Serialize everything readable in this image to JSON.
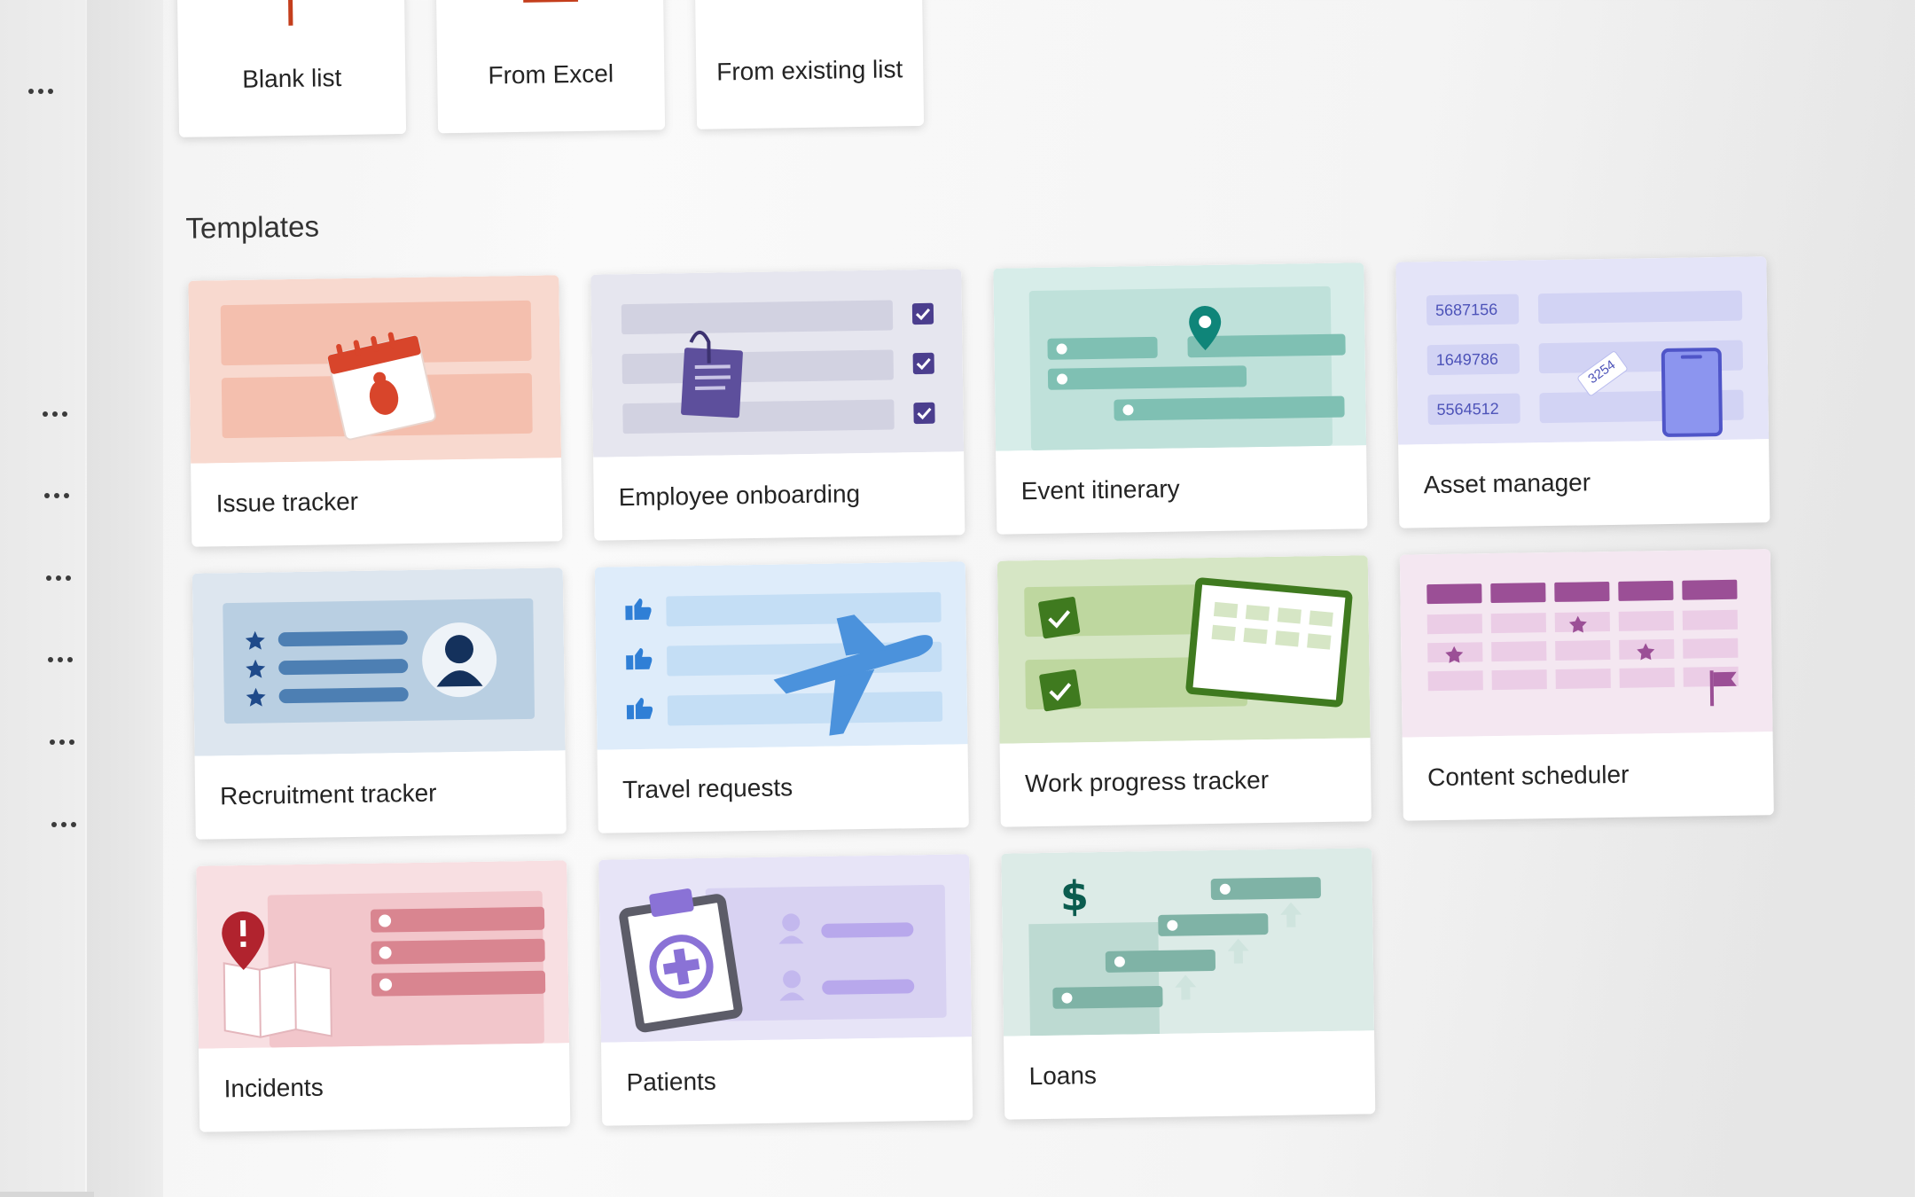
{
  "create": {
    "blank_list": "Blank list",
    "from_excel": "From Excel",
    "from_existing_list": "From existing list"
  },
  "templates": {
    "title": "Templates",
    "cards": [
      {
        "name": "Issue tracker"
      },
      {
        "name": "Employee onboarding"
      },
      {
        "name": "Event itinerary"
      },
      {
        "name": "Asset manager",
        "asset_numbers": [
          "5687156",
          "1649786",
          "5564512"
        ],
        "tag": "3254"
      },
      {
        "name": "Recruitment tracker"
      },
      {
        "name": "Travel requests"
      },
      {
        "name": "Work progress tracker"
      },
      {
        "name": "Content scheduler"
      },
      {
        "name": "Incidents"
      },
      {
        "name": "Patients"
      },
      {
        "name": "Loans",
        "currency_symbol": "$"
      }
    ]
  },
  "sidebar": {
    "more_icon": "ellipsis-icon"
  },
  "colors": {
    "issue": "#f8d9cf",
    "onboarding": "#e6e6ef",
    "event": "#d7ede9",
    "asset": "#e4e4f8",
    "recruit": "#dde6ef",
    "travel": "#deecfa",
    "work": "#d6e6c5",
    "content": "#f4e7f1",
    "incidents": "#f8dfe2",
    "patients": "#e7e4f7",
    "loans": "#dcebe7"
  }
}
